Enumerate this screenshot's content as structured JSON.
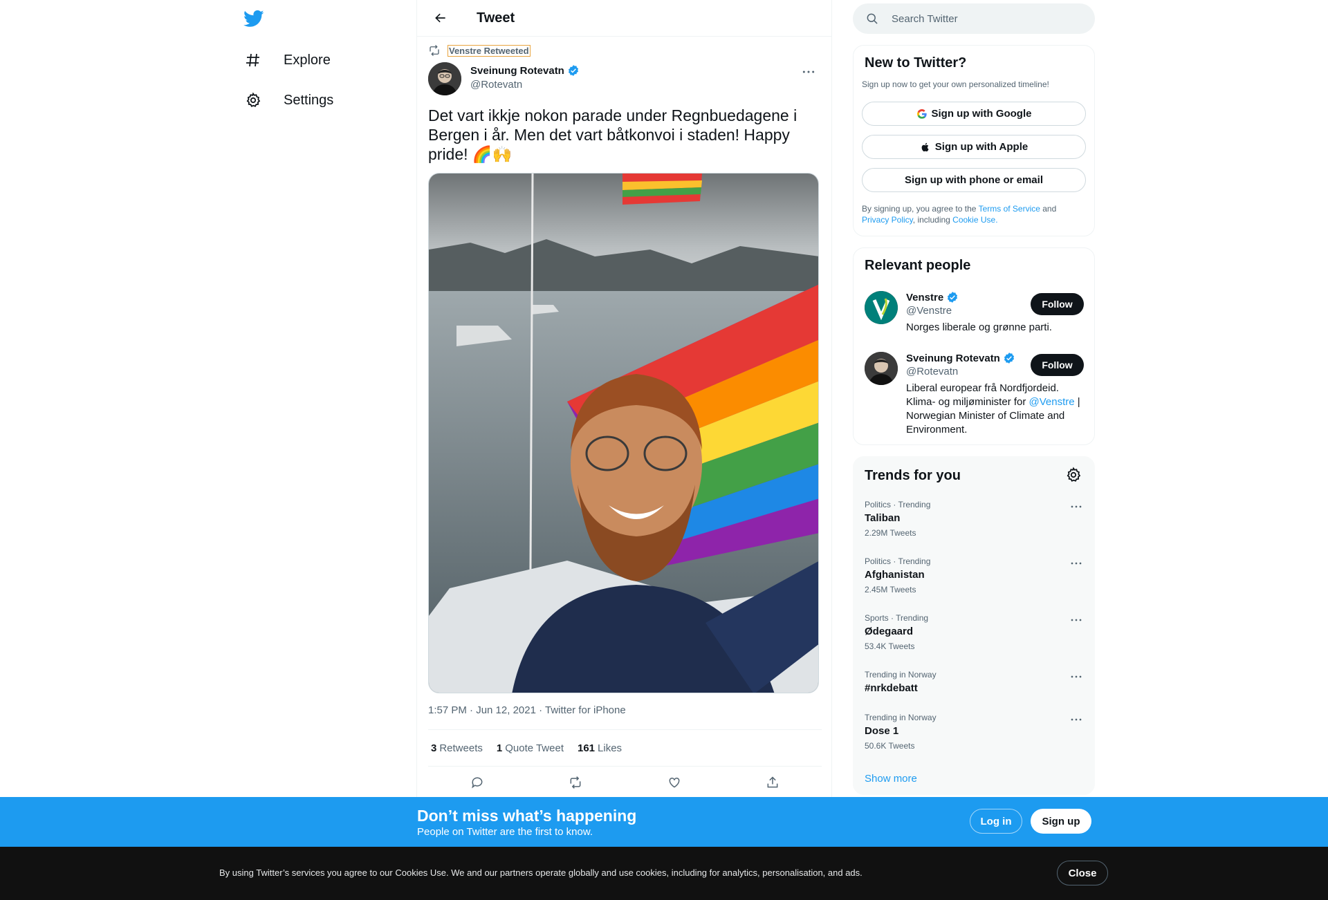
{
  "nav": {
    "items": [
      {
        "label": "Explore",
        "icon": "hashtag-icon"
      },
      {
        "label": "Settings",
        "icon": "gear-icon"
      }
    ]
  },
  "header": {
    "title": "Tweet"
  },
  "tweet": {
    "retweeted_by": "Venstre Retweeted",
    "author_name": "Sveinung Rotevatn",
    "author_handle": "@Rotevatn",
    "text": "Det vart ikkje nokon parade under Regnbuedagene i Bergen i år. Men det vart båtkonvoi i staden! Happy pride! 🌈🙌",
    "meta": "1:57 PM · Jun 12, 2021 · Twitter for iPhone",
    "retweets_count": "3",
    "retweets_label": "Retweets",
    "quotes_count": "1",
    "quotes_label": "Quote Tweet",
    "likes_count": "161",
    "likes_label": "Likes"
  },
  "search": {
    "placeholder": "Search Twitter"
  },
  "new_to_twitter": {
    "title": "New to Twitter?",
    "subtitle": "Sign up now to get your own personalized timeline!",
    "google_label": "Sign up with Google",
    "apple_label": "Sign up with Apple",
    "phone_label": "Sign up with phone or email",
    "legal_prefix": "By signing up, you agree to the ",
    "terms": "Terms of Service",
    "and": " and",
    "privacy": "Privacy Policy",
    "including": ", including ",
    "cookie": "Cookie Use."
  },
  "relevant_people": {
    "title": "Relevant people",
    "people": [
      {
        "name": "Venstre",
        "handle": "@Venstre",
        "bio": "Norges liberale og grønne parti.",
        "follow": "Follow"
      },
      {
        "name": "Sveinung Rotevatn",
        "handle": "@Rotevatn",
        "bio_prefix": "Liberal europear frå Nordfjordeid. Klima- og miljøminister for ",
        "bio_link": "@Venstre",
        "bio_suffix": " | Norwegian Minister of Climate and Environment.",
        "follow": "Follow"
      }
    ]
  },
  "trends": {
    "title": "Trends for you",
    "items": [
      {
        "context": "Politics · Trending",
        "topic": "Taliban",
        "count": "2.29M Tweets"
      },
      {
        "context": "Politics · Trending",
        "topic": "Afghanistan",
        "count": "2.45M Tweets"
      },
      {
        "context": "Sports · Trending",
        "topic": "Ødegaard",
        "count": "53.4K Tweets"
      },
      {
        "context": "Trending in Norway",
        "topic": "#nrkdebatt",
        "count": ""
      },
      {
        "context": "Trending in Norway",
        "topic": "Dose 1",
        "count": "50.6K Tweets"
      }
    ],
    "show_more": "Show more"
  },
  "signup_banner": {
    "headline": "Don’t miss what’s happening",
    "subline": "People on Twitter are the first to know.",
    "login": "Log in",
    "signup": "Sign up"
  },
  "cookie_banner": {
    "text": "By using Twitter’s services you agree to our Cookies Use. We and our partners operate globally and use cookies, including for analytics, personalisation, and ads.",
    "close": "Close"
  },
  "colors": {
    "accent": "#1d9bf0",
    "text": "#0f1419",
    "muted": "#536471"
  }
}
